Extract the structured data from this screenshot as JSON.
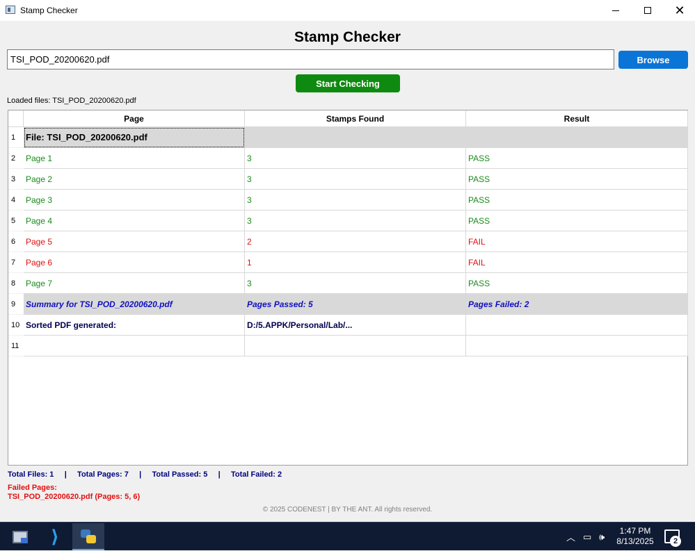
{
  "window": {
    "title": "Stamp Checker"
  },
  "app": {
    "heading": "Stamp Checker",
    "file_input_value": "TSI_POD_20200620.pdf",
    "browse_label": "Browse",
    "start_label": "Start Checking",
    "loaded_files": "Loaded files: TSI_POD_20200620.pdf"
  },
  "table": {
    "columns": [
      "Page",
      "Stamps Found",
      "Result"
    ],
    "row_numbers": [
      "1",
      "2",
      "3",
      "4",
      "5",
      "6",
      "7",
      "8",
      "9",
      "10",
      "11"
    ],
    "rows": [
      {
        "type": "file",
        "cells": [
          "File: TSI_POD_20200620.pdf",
          "",
          ""
        ]
      },
      {
        "type": "pass",
        "cells": [
          "Page 1",
          "3",
          "PASS"
        ]
      },
      {
        "type": "pass",
        "cells": [
          "Page 2",
          "3",
          "PASS"
        ]
      },
      {
        "type": "pass",
        "cells": [
          "Page 3",
          "3",
          "PASS"
        ]
      },
      {
        "type": "pass",
        "cells": [
          "Page 4",
          "3",
          "PASS"
        ]
      },
      {
        "type": "fail",
        "cells": [
          "Page 5",
          "2",
          "FAIL"
        ]
      },
      {
        "type": "fail",
        "cells": [
          "Page 6",
          "1",
          "FAIL"
        ]
      },
      {
        "type": "pass",
        "cells": [
          "Page 7",
          "3",
          "PASS"
        ]
      },
      {
        "type": "summary",
        "cells": [
          "Summary for TSI_POD_20200620.pdf",
          "Pages Passed: 5",
          "Pages Failed: 2"
        ]
      },
      {
        "type": "sorted",
        "cells": [
          "Sorted PDF generated:",
          "D:/5.APPK/Personal/Lab/...",
          ""
        ]
      },
      {
        "type": "empty",
        "cells": [
          "",
          "",
          ""
        ]
      }
    ]
  },
  "footer": {
    "totals": "Total Files: 1     |     Total Pages: 7     |     Total Passed: 5     |     Total Failed: 2",
    "failed_label": "Failed Pages:",
    "failed_detail": "TSI_POD_20200620.pdf (Pages: 5, 6)",
    "copyright": "© 2025 CODENEST | BY THE ANT. All rights reserved."
  },
  "taskbar": {
    "time": "1:47 PM",
    "date": "8/13/2025",
    "notification_count": "2"
  },
  "colors": {
    "pass": "#1a8a1a",
    "fail": "#e01010",
    "browse": "#0a75d6",
    "start": "#0f8a10",
    "summary": "#1010c0"
  }
}
